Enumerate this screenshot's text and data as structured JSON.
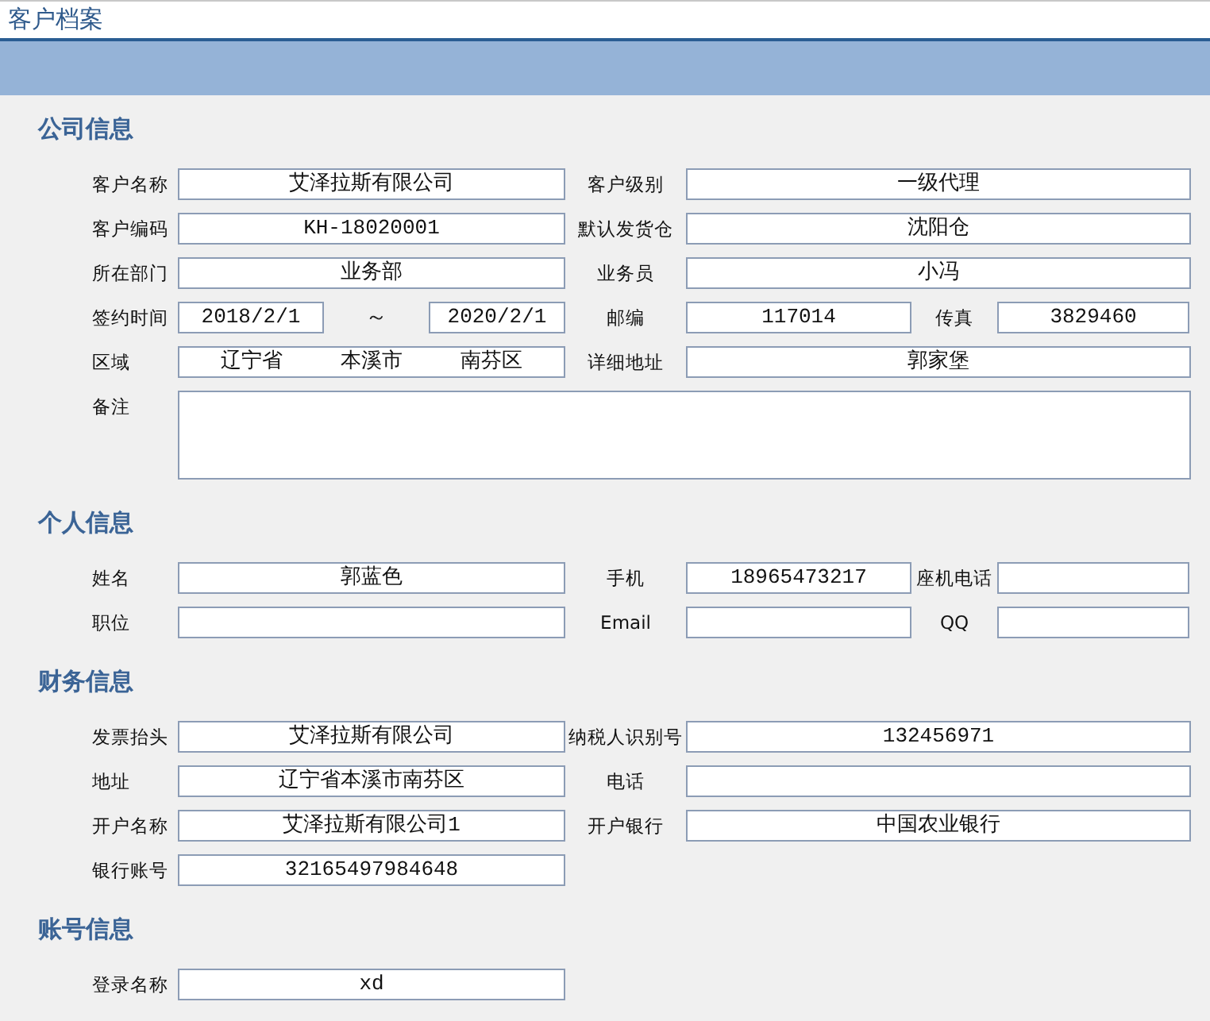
{
  "window": {
    "title": "客户档案"
  },
  "sections": [
    {
      "title": "公司信息",
      "rows": [
        {
          "kind": "pair",
          "items": [
            {
              "kind": "label",
              "text": "客户名称"
            },
            {
              "kind": "field",
              "value": "艾泽拉斯有限公司"
            },
            {
              "kind": "label",
              "text": "客户级别"
            },
            {
              "kind": "field",
              "value": "一级代理"
            }
          ]
        },
        {
          "kind": "pair",
          "items": [
            {
              "kind": "label",
              "text": "客户编码"
            },
            {
              "kind": "field",
              "value": "KH-18020001"
            },
            {
              "kind": "label",
              "text": "默认发货仓"
            },
            {
              "kind": "field",
              "value": "沈阳仓"
            }
          ]
        },
        {
          "kind": "pair",
          "items": [
            {
              "kind": "label",
              "text": "所在部门"
            },
            {
              "kind": "field",
              "value": "业务部"
            },
            {
              "kind": "label",
              "text": "业务员"
            },
            {
              "kind": "field",
              "value": "小冯"
            }
          ]
        },
        {
          "kind": "date",
          "items": [
            {
              "kind": "label",
              "text": "签约时间"
            },
            {
              "kind": "field",
              "value": "2018/2/1"
            },
            {
              "kind": "tilde",
              "text": "～"
            },
            {
              "kind": "field",
              "value": "2020/2/1"
            },
            {
              "kind": "label",
              "text": "邮编"
            },
            {
              "kind": "field",
              "value": "117014"
            },
            {
              "kind": "label",
              "text": "传真"
            },
            {
              "kind": "field",
              "value": "3829460"
            }
          ]
        },
        {
          "kind": "pair",
          "items": [
            {
              "kind": "label",
              "text": "区域"
            },
            {
              "kind": "region",
              "values": [
                "辽宁省",
                "本溪市",
                "南芬区"
              ]
            },
            {
              "kind": "label",
              "text": "详细地址"
            },
            {
              "kind": "field",
              "value": "郭家堡"
            }
          ]
        },
        {
          "kind": "memo",
          "items": [
            {
              "kind": "label",
              "text": "备注"
            },
            {
              "kind": "memo"
            }
          ]
        }
      ]
    },
    {
      "title": "个人信息",
      "rows": [
        {
          "kind": "quad",
          "items": [
            {
              "kind": "label",
              "text": "姓名"
            },
            {
              "kind": "field",
              "value": "郭蓝色"
            },
            {
              "kind": "label",
              "text": "手机"
            },
            {
              "kind": "field",
              "value": "18965473217"
            },
            {
              "kind": "label",
              "text": "座机电话"
            },
            {
              "kind": "field"
            }
          ]
        },
        {
          "kind": "quad",
          "items": [
            {
              "kind": "label",
              "text": "职位"
            },
            {
              "kind": "field"
            },
            {
              "kind": "label",
              "text": "Email"
            },
            {
              "kind": "field"
            },
            {
              "kind": "label",
              "text": "QQ"
            },
            {
              "kind": "field"
            }
          ]
        }
      ]
    },
    {
      "title": "财务信息",
      "rows": [
        {
          "kind": "pair",
          "items": [
            {
              "kind": "label",
              "text": "发票抬头"
            },
            {
              "kind": "field",
              "value": "艾泽拉斯有限公司"
            },
            {
              "kind": "label",
              "text": "纳税人识别号"
            },
            {
              "kind": "field",
              "value": "132456971"
            }
          ]
        },
        {
          "kind": "pair",
          "items": [
            {
              "kind": "label",
              "text": "地址"
            },
            {
              "kind": "field",
              "value": "辽宁省本溪市南芬区"
            },
            {
              "kind": "label",
              "text": "电话"
            },
            {
              "kind": "field"
            }
          ]
        },
        {
          "kind": "pair",
          "items": [
            {
              "kind": "label",
              "text": "开户名称"
            },
            {
              "kind": "field",
              "value": "艾泽拉斯有限公司1"
            },
            {
              "kind": "label",
              "text": "开户银行"
            },
            {
              "kind": "field",
              "value": "中国农业银行"
            }
          ]
        },
        {
          "kind": "single",
          "items": [
            {
              "kind": "label",
              "text": "银行账号"
            },
            {
              "kind": "field",
              "value": "32165497984648"
            }
          ]
        }
      ]
    },
    {
      "title": "账号信息",
      "rows": [
        {
          "kind": "single",
          "items": [
            {
              "kind": "label",
              "text": "登录名称"
            },
            {
              "kind": "field",
              "value": "xd"
            }
          ]
        }
      ]
    }
  ]
}
